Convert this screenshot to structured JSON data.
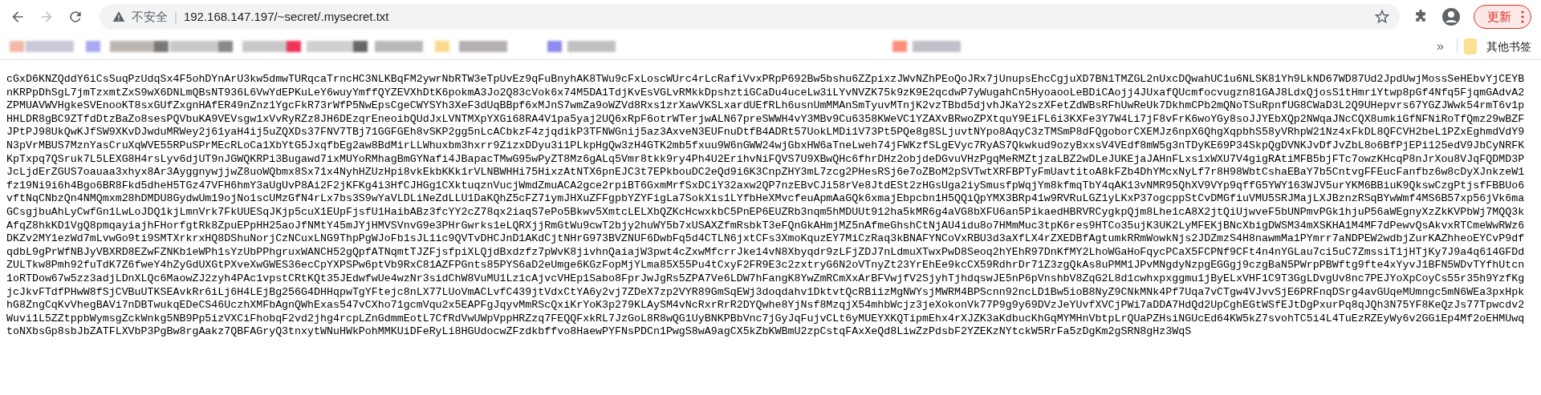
{
  "toolbar": {
    "security_label": "不安全",
    "separator": "|",
    "url": "192.168.147.197/~secret/.mysecret.txt",
    "update_button": "更新"
  },
  "bookmarks_bar": {
    "overflow": "»",
    "other_bookmarks": "其他书签"
  },
  "document": {
    "lines": [
      "cGxD6KNZQddY6iCsSuqPzUdqSx4F5ohDYnArU3kw5dmwTURqcaTrncHC3NLKBqFM2ywrNbRTW3eTpUvEz9qFuBnyhAK8TWu9cFxLoscWUrc4rLcRafiVvxPRpP692Bw5bshu6ZZpixzJWvNZhPEoQoJRx7jUnupsEhcCgjuXD7BN1TMZGL2nUxcDQwahUC1u6NLSK81Yh9LkND67WD87Ud2JpdUwjMossSeHEbvYjCEYB",
      "nKRPpDhSgL7jmTzxmtZxS9wX6DNLmQBsNT936L6VwYdEPKuLeY6wuyYmffQYZEVXhDtK6pokmA3Jo2Q83cVok6x74M5DA1TdjKvEsVGLvRMkkDpshztiGCaDu4uceLw3iLYvNVZK75k9zK9E2qcdwP7yWugahCn5HyoaooLeBDiCAojj4JUxafQUcmfocvugzn81GAJ8LdxQjosS1tHmriYtwp8pGf4Nfq5FjqmGAdvA2",
      "ZPMUAVWVHgkeSVEnooKT8sxGUfZxgnHAfER49nZnz1YgcFkR73rWfP5NwEpsCgeCWYSYh3XeF3dUqBBpf6xMJnS7wmZa9oWZVd8Rxs1zrXawVKSLxardUEfRLh6usnUmMMAnSmTyuvMTnjK2vzTBbd5djvhJKaY2szXFetZdWBsRFhUwReUk7DkhmCPb2mQNoTSuRpnfUG8CWaD3L2Q9UHepvrs67YGZJWwk54rmT6v1p",
      "HHLDR8gBC9ZTfdDtzBaZo8sesPQVbuKA9VEVsgw1xVvRyRZz8JH6DEzqrEneoibQUdJxLVNTMXpYXGi68RA4V1pa5yaj2UQ6xRpF6otrWTerjwALN67preSWWH4vY3MBv9Cu6358KWeVC1YZAXvBRwoZPXtquY9EiFL6i3KXFe3Y7W4Li7jF8vFrK6woYGy8soJJYEbXQp2NWqaJNcCQX8umkiGfNFNiRoTfQmz29wBZF",
      "JPtPJ98UkQwKJfSW9XKvDJwduMRWey2j61yaH4ij5uZQXDs37FNV7TBj71GGFGEh8vSKP2gg5nLcACbkzF4zjqdikP3TFNWGnij5az3AxveN3EUFnuDtfB4ADRt57UokLMDi1V73Pt5PQe8g8SLjuvtNYpo8AqyC3zTMSmP8dFQgoborCXEMJz6npX6QhgXqpbhS58yVRhpW21Nz4xFkDL8QFCVH2beL1PZxEghmdVdY9",
      "N3pVrMBUS7MznYasCruXqWVE55RPuSPrMEcRLoCa1XbYtG5JxqfbEg2aw8BdMirLLWhuxbm3hxrr9ZizxDDyu3i1PLkpHgQw3zH4GTK2mb5fxuu9W6nGWW24wjGbxHW6aTneLweh74jFWKzfSLgEVyc7RyAS7Qkwkud9ozyBxxsV4VEdf8mW5g3nTDyKE69P34SkpQgDVNKJvDfJvZbL8o6BfPjEPi125edV9JbCyNRFK",
      "KpTxpq7QSruk7L5LEXG8H4rsLyv6djUT9nJGWQKRPi3Bugawd7ixMUYoRMhagBmGYNafi4JBapacTMwG95wPyZT8Mz6gALq5Vmr8tkk9ry4Ph4U2ErihvNiFQVS7U9XBwQHc6fhrDHz2objdeDGvuVHzPgqMeRMZtjzaLBZ2wDLeJUKEjaJAHnFLxs1xWXU7V4gigRAtiMFB5bjFTc7owzKHcqP8nJrXou8VJqFQDMD3P",
      "JcLjdErZGUS7oauaa3xhyx8Ar3AyggnywjjwZ8uoWQbmx8Sx71x4NyhHZUzHpi8vkEkbKKk1rVLNBWHHi75HixzAtNTX6pnEJC3t7EPkbouDC2eQd9i6K3CnpZHY3mL7zcg2PHesRSj6e7oZBoM2pSVTwtXRFBPTyFmUavtitoA8kFZb4DhYMcxNyLf7r8H98WbtCshaEBaY7b5CntvgFFEucFanfbz6w8cDyXJnkzeW1",
      "fz19Ni9i6h4Bgo6BR8Fkd5dheH5TGz47VFH6hmY3aUgUvP8Ai2F2jKFKg4i3HfCJHGg1CXktuqznVucjWmdZmuACA2gce2rpiBT6GxmMrfSxDCiY32axw2QP7nzEBvCJi58rVe8JtdESt2zHGsUga2iySmusfpWqjYm8kfmqTbY4qAK13vNMR95QhXV9VYp9qffG5YWY163WJV5urYKM6BBiuK9QkswCzgPtjsfFBBUo6",
      "vftNqCNbzQn4NMQmxm28hDMDU8GydwUm19ojNo1scUMzGfN4rLx7bs3S9wYaVLDLiNeZdLLU1DaKQhZ5cFZ7iymJHXuZFFgpbYZYFigLa7SokXis1LYfbHeXMvcfeuApmAaGQk6xmajEbpcbn1H5QQiQpYMX3BRp41w9RVRuLGZ1yLKxP37ogcppStCvDMGfiuVMU5SRJMajLXJBznzRSqBYwWmf4MS6B57xp56jVk6ma",
      "GCsgjbuAhLyCwfGn1LwLoJDQ1kjLmnVrk7FkUUESqJKjp5cuX1EUpFjsfU1HaibABz3fcYY2cZ78qx2iaqS7ePo5Bkwv5XmtcLELXbQZKcHcwxkbC5PnEP6EUZRb3nqm5hMDUUt912ha5kMR6g4aVG8bXFU6an5PikaedHBRVRCygkpQjm8Lhe1cA8X2jtQiUjwveF5bUNPmvPGk1hjuP56aWEgnyXzZkKVPbWj7MQQ3k",
      "AfqZ8hkKD1VgQ8pmqayiajhFHorfgtRk8ZpuEPpHH25aoJfNMtY45mJYjHMVSVnvG9e3PHrGwrks1eLQRXjjRmGtWu9cwT2bjy2huWY5b7xUSAXZfmRsbkT3eFQnGkAHmjMZ5nAfmeGhshCtNjAU4idu8o7HMmMuc3tpK6res9HTCo35ujK3UK2LyMFEKjBNcXbigDWSM34mXSKHA1M4MF7dPewvQsAkvxRTCmeWwRWz6",
      "DKZv2MY1ezWd7mLvwGo9ti9SMTXrkrxHQ8DShuNorjCzNCuxLNG9ThpPgWJoFb1sJL1ic9QVTvDHCJnD1AKdCjtNHrG973BVZNUF6DwbFq5d4CTLN6jxtCFs3XmoKquzEY7MiCzRaq3kBNAFYNCoVxRBU3d3aXfLX4rZXEDBfAgtumkRRmWowkNjs2JDZmzS4H8nawmMa1PYmrr7aNDPEW2wdbjZurKAZhheoEYCvP9df",
      "qdbL9gPrWfNBJyVBXRD8EZwFZNKb1eWPh1sYzUbPPhgruxWANCH52gQpfATNqmtTJZFjsfpiXLQjdBxdzfz7pWvK8jivhnQaiajW3pwt4cZxwMfcrrJke14vN8Xbyqdr9zLFjZDJ7nLdmuXTwxPwD8Seoq2hYEhR97DnKfMY2LhoWGaHoFqycPCaX5FCPNf9CFt4n4nYGLau7ci5uC7ZmssiT1jHTjKy7J9a4q614GFDd",
      "ZULTkw8Pmh92fuTdK7Z6fweY4hZyGdUXGtPXveXwGWES36ecCpYXPSPw6ptVb9RxC81AZFPGnts85PYS6aD2eUmge6KGzFopMjYLma85X55Pu4tCxyF2FR9E3c2zxtryG6N2oVTnyZt23YrEhEe9kcCX59RdhrDr71Z3zgQkAs8uPMM1JPvMNgdyNzpgEGGgj9czgBaN5PWrpPBWftg9fte4xYyvJ1BFN5WDvTYfhUtcn",
      "1oRTDow67w5zz3adjLDnXLQc6MaowZJ2zyh4PAc1vpstCRtKQt35JEdwfwUe4wzNr3sidChW8VuMU1Lz1cAjvcVHEp1Sabo8FprJwJgRs5ZPA7Ve6LDW7hFangK8YwZmRCmXxArBFVwjfV2SjyhTjhdqswJE5nP6pVnshbV8ZqG2L8d1cwhxpxggmu1jByELxVHF1C9T3GgLDvgUv8nc7PEJYoXpCoyCs55r35h9YzfKg",
      "jcJkvFTdfPHwW8fSjCVBuUTKSEAvkRr6iLj6H4LEjBg256G4DHHqpwTgYFtejc8nLX77LUoVmACLvfC439jtVdxCtYA6y2vj7ZDeX7zp2VYR89GmSqEWj3doqdahv1DktvtQcRBiizMgNWYsjMWRM4BPScnn92ncLD1Bw5ioB8NyZ9CNkMNk4Pf7Uqa7vCTgw4VJvvSjE6PRFnqDSrg4avGUqeMUmngc5mN6WEa3pxHpk",
      "hG8ZngCqKvVhegBAVi7nDBTwukqEDeCS46UczhXMFbAgnQWhExas547vCXho71gcmVqu2x5EAPFgJqyvMmRScQxiKrYoK3p279KLAySM4vNcRxrRrR2DYQwhe8YjNsf8MzqjX54mhbWcjz3jeXokonVk77P9g9y69DVzJeYUvfXVCjPWi7aDDA7HdQd2UpCghEGtWSfEJtDgPxurPq8qJQh3N75YF8KeQzJs77Tpwcdv2",
      "Wuvi1L5ZZtppbWymsgZckWnkg5NB9Pp5izVXCiFhobqF2vd2jhg4rcpLZnGdmmEotL7CfRdVwUWpVppHRZzq7FEQQFxkRL7JzGoL8R8wQG1UyBNKPBbVnc7jGyJqFujvCLt6yMUEYXKQTipmEhx4rXJZK3aKdbucKhGqMYMHnVbtpLrQUaPZHsiNGUcEd64KW5kZ7svohTC5i4L4TuEzRZEyWy6v2GGiEp4Mf2oEHMUwq",
      "toNXbsGp8sbJbZATFLXVbP3PgBw8rgAakz7QBFAGryQ3tnxytWNuHWkPohMMKUiDFeRyLi8HGUdocwZFzdkbffvo8HaewPYFNsPDCn1PwgS8wA9agCX5kZbKWBmU2zpCstqFAxXeQd8LiwZzPdsbF2YZEKzNYtckW5RrFa5zDgKm2gSRN8gHz3WqS"
    ]
  }
}
